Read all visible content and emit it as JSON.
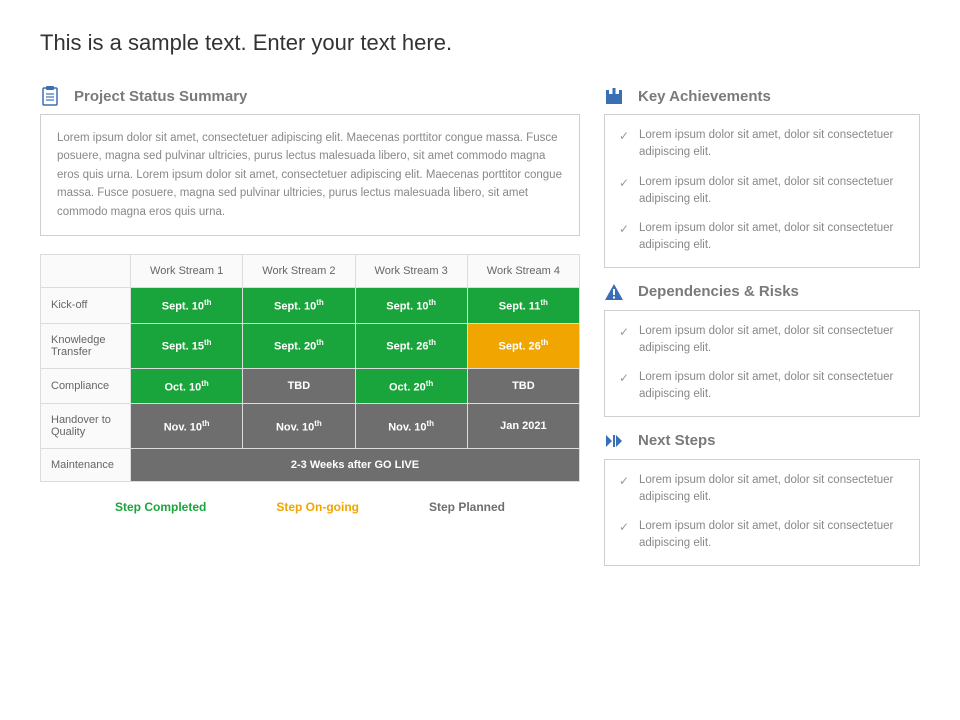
{
  "title": "This is a sample text. Enter your text here.",
  "summary": {
    "heading": "Project Status Summary",
    "body": "Lorem ipsum dolor sit amet, consectetuer adipiscing elit. Maecenas porttitor congue massa. Fusce posuere, magna sed pulvinar ultricies, purus lectus malesuada libero, sit amet commodo magna eros quis urna. Lorem ipsum dolor sit amet, consectetuer adipiscing elit. Maecenas porttitor congue massa. Fusce posuere, magna sed pulvinar ultricies, purus lectus malesuada libero, sit amet commodo magna eros quis urna."
  },
  "table": {
    "columns": [
      "Work Stream 1",
      "Work Stream 2",
      "Work Stream 3",
      "Work Stream 4"
    ],
    "rows": [
      {
        "label": "Kick-off",
        "cells": [
          {
            "text": "Sept. 10",
            "sup": "th",
            "status": "completed"
          },
          {
            "text": "Sept. 10",
            "sup": "th",
            "status": "completed"
          },
          {
            "text": "Sept. 10",
            "sup": "th",
            "status": "completed"
          },
          {
            "text": "Sept. 11",
            "sup": "th",
            "status": "completed"
          }
        ]
      },
      {
        "label": "Knowledge Transfer",
        "cells": [
          {
            "text": "Sept. 15",
            "sup": "th",
            "status": "completed"
          },
          {
            "text": "Sept. 20",
            "sup": "th",
            "status": "completed"
          },
          {
            "text": "Sept. 26",
            "sup": "th",
            "status": "completed"
          },
          {
            "text": "Sept. 26",
            "sup": "th",
            "status": "ongoing"
          }
        ]
      },
      {
        "label": "Compliance",
        "cells": [
          {
            "text": "Oct. 10",
            "sup": "th",
            "status": "completed"
          },
          {
            "text": "TBD",
            "sup": "",
            "status": "planned"
          },
          {
            "text": "Oct. 20",
            "sup": "th",
            "status": "completed"
          },
          {
            "text": "TBD",
            "sup": "",
            "status": "planned"
          }
        ]
      },
      {
        "label": "Handover to Quality",
        "cells": [
          {
            "text": "Nov. 10",
            "sup": "th",
            "status": "planned"
          },
          {
            "text": "Nov. 10",
            "sup": "th",
            "status": "planned"
          },
          {
            "text": "Nov. 10",
            "sup": "th",
            "status": "planned"
          },
          {
            "text": "Jan 2021",
            "sup": "",
            "status": "planned"
          }
        ]
      },
      {
        "label": "Maintenance",
        "merged": {
          "text": "2-3 Weeks after GO LIVE",
          "status": "planned"
        }
      }
    ]
  },
  "legend": {
    "completed": "Step Completed",
    "ongoing": "Step On-going",
    "planned": "Step Planned"
  },
  "right": {
    "achievements": {
      "heading": "Key Achievements",
      "items": [
        "Lorem ipsum dolor sit amet, dolor sit consectetuer adipiscing elit.",
        "Lorem ipsum dolor sit amet, dolor sit consectetuer adipiscing elit.",
        "Lorem ipsum dolor sit amet, dolor sit consectetuer adipiscing elit."
      ]
    },
    "risks": {
      "heading": "Dependencies & Risks",
      "items": [
        "Lorem ipsum dolor sit amet, dolor sit consectetuer adipiscing elit.",
        "Lorem ipsum dolor sit amet, dolor sit consectetuer adipiscing elit."
      ]
    },
    "next": {
      "heading": "Next Steps",
      "items": [
        "Lorem ipsum dolor sit amet, dolor sit consectetuer adipiscing elit.",
        "Lorem ipsum dolor sit amet, dolor sit consectetuer adipiscing elit."
      ]
    }
  }
}
